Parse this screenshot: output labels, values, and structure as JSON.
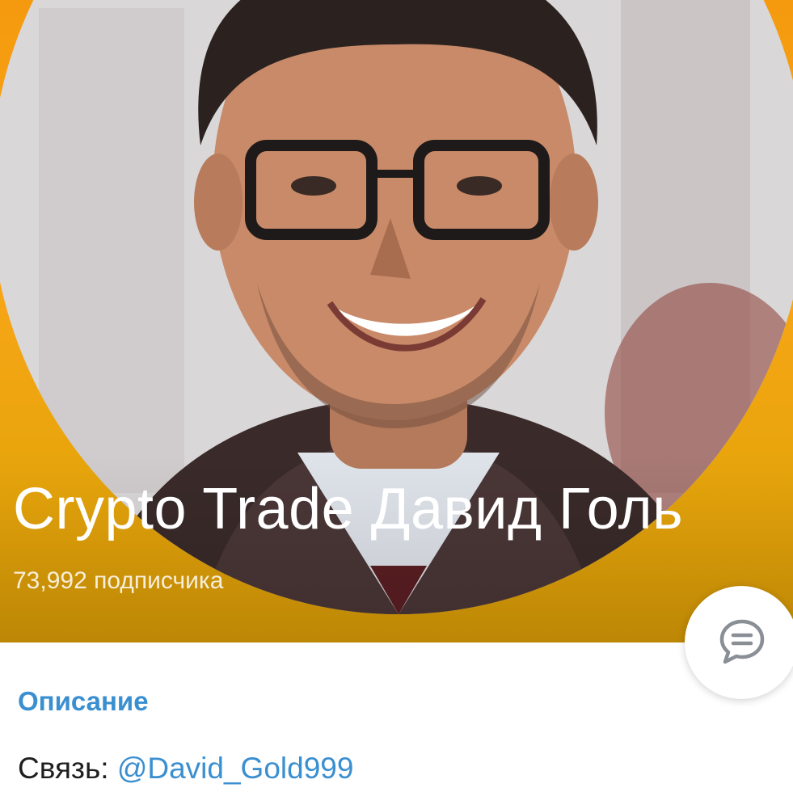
{
  "channel": {
    "title": "Crypto Trade    Давид Голь",
    "subscribers": "73,992 подписчика"
  },
  "about": {
    "section_title": "Описание",
    "contact_label": "Связь: ",
    "contact_link": "@David_Gold999"
  },
  "icons": {
    "fab": "message-bubble-icon",
    "avatar": "profile-photo"
  },
  "colors": {
    "header_orange": "#f7a516",
    "link_blue": "#3a8fd0"
  }
}
